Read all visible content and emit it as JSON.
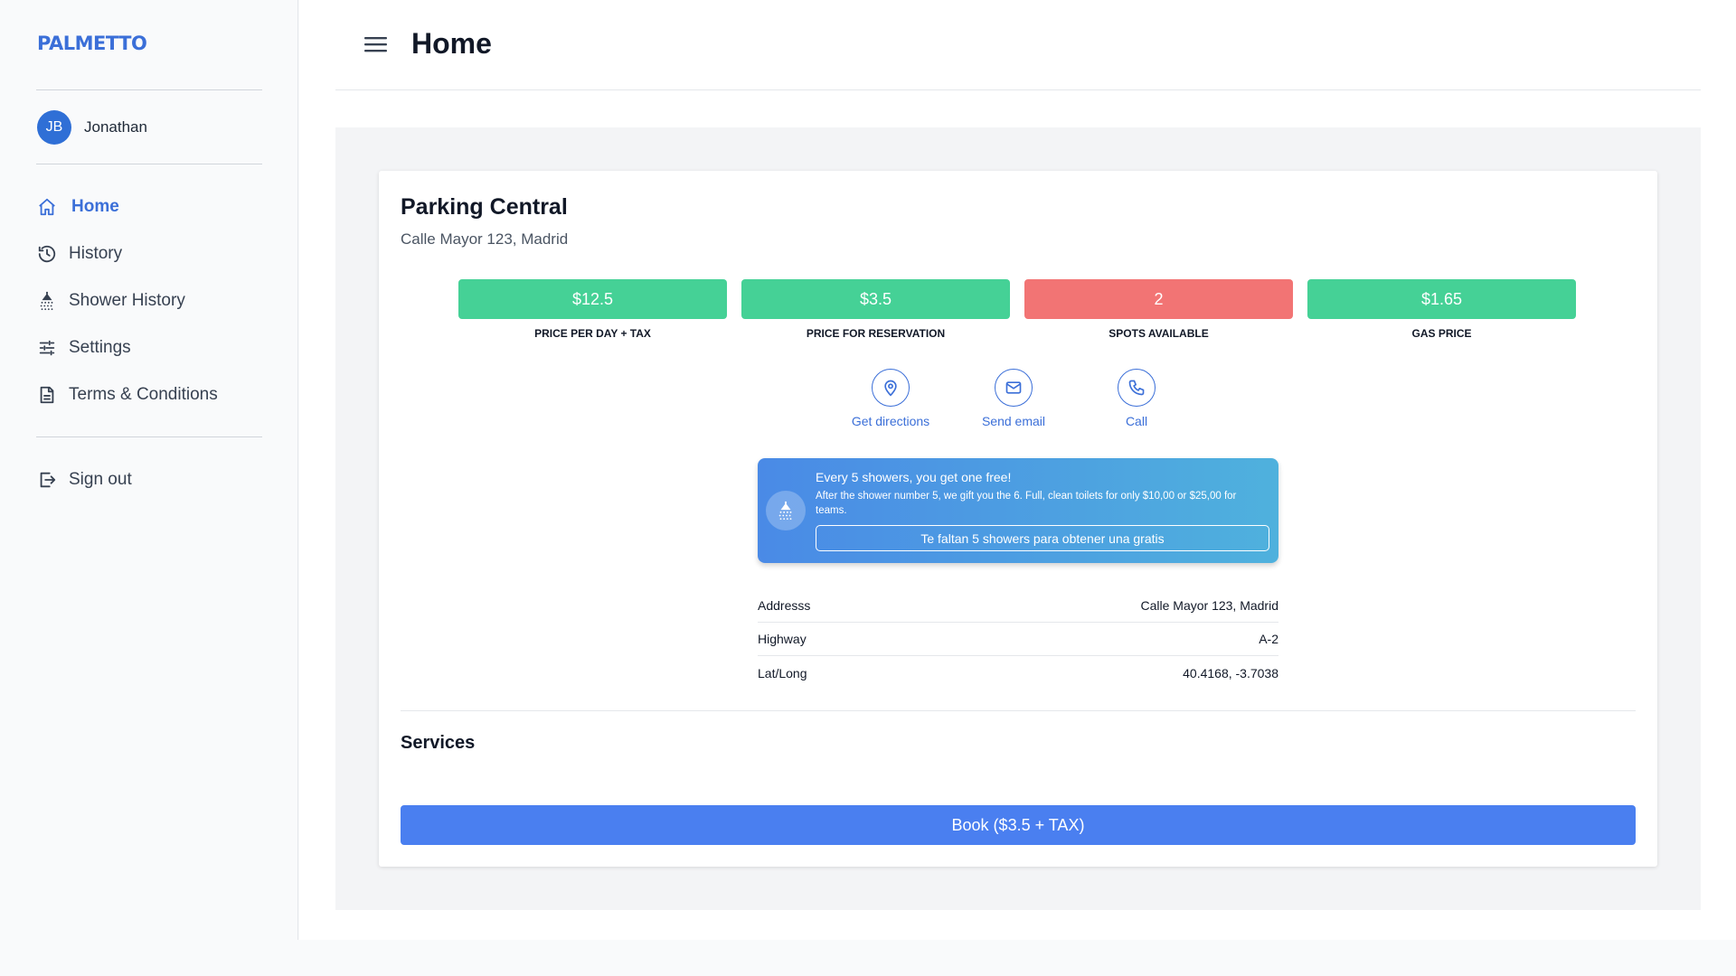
{
  "app": {
    "logo": "PALMETTO"
  },
  "user": {
    "initials": "JB",
    "name": "Jonathan"
  },
  "sidebar": {
    "items": [
      {
        "label": "Home",
        "icon": "home-icon",
        "active": true
      },
      {
        "label": "History",
        "icon": "history-icon"
      },
      {
        "label": "Shower History",
        "icon": "shower-icon"
      },
      {
        "label": "Settings",
        "icon": "sliders-icon"
      },
      {
        "label": "Terms & Conditions",
        "icon": "document-icon"
      }
    ],
    "signout": "Sign out"
  },
  "header": {
    "title": "Home"
  },
  "place": {
    "name": "Parking Central",
    "address": "Calle Mayor 123, Madrid",
    "stats": [
      {
        "value": "$12.5",
        "label": "PRICE PER DAY + TAX",
        "color": "#45d196"
      },
      {
        "value": "$3.5",
        "label": "PRICE FOR RESERVATION",
        "color": "#45d196"
      },
      {
        "value": "2",
        "label": "SPOTS AVAILABLE",
        "color": "#f27474"
      },
      {
        "value": "$1.65",
        "label": "GAS PRICE",
        "color": "#45d196"
      }
    ],
    "actions": [
      {
        "label": "Get directions",
        "icon": "map-pin-icon"
      },
      {
        "label": "Send email",
        "icon": "mail-icon"
      },
      {
        "label": "Call",
        "icon": "phone-icon"
      }
    ],
    "promo": {
      "title": "Every 5 showers, you get one free!",
      "description": "After the shower number 5, we gift you the 6. Full, clean toilets for only $10,00 or $25,00 for teams.",
      "button": "Te faltan 5 showers para obtener una gratis"
    },
    "info": [
      {
        "key": "Addresss",
        "value": "Calle Mayor 123, Madrid"
      },
      {
        "key": "Highway",
        "value": "A-2"
      },
      {
        "key": "Lat/Long",
        "value": "40.4168, -3.7038"
      }
    ],
    "services_title": "Services",
    "book_button": "Book ($3.5 + TAX)"
  },
  "colors": {
    "accent": "#3b6fd8",
    "book": "#4a7ff0",
    "green": "#45d196",
    "red": "#f27474"
  }
}
